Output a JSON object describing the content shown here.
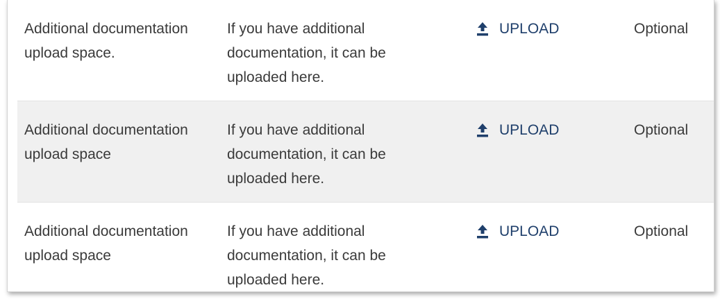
{
  "rows": [
    {
      "name": "Additional documentation upload space.",
      "description": "If you have additional documentation, it can be uploaded here.",
      "upload_label": "UPLOAD",
      "upload_icon": "upload-icon",
      "status": "Optional"
    },
    {
      "name": "Additional documentation upload space",
      "description": "If you have additional documentation, it can be uploaded here.",
      "upload_label": "UPLOAD",
      "upload_icon": "upload-icon",
      "status": "Optional"
    },
    {
      "name": "Additional documentation upload space",
      "description": "If you have additional documentation, it can be uploaded here.",
      "upload_label": "UPLOAD",
      "upload_icon": "upload-icon",
      "status": "Optional"
    }
  ],
  "colors": {
    "link": "#1f3f6b",
    "text": "#3a3a3a",
    "alt_row": "#f0f0f0"
  }
}
